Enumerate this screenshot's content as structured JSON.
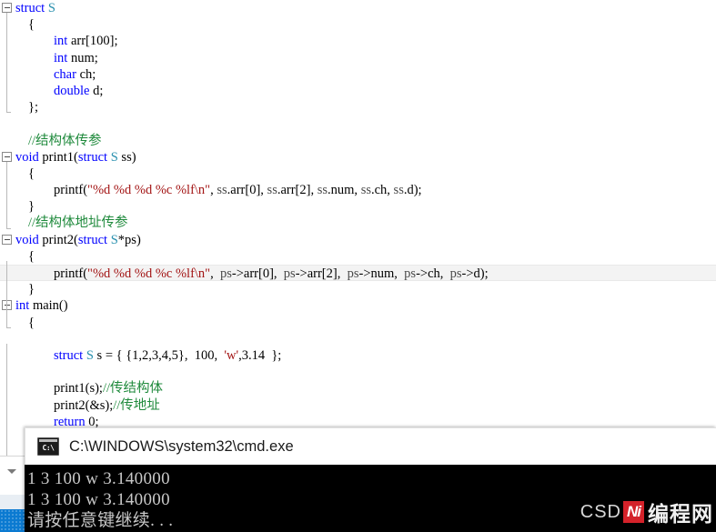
{
  "editor": {
    "lines": [
      {
        "indent": 0,
        "fold": true,
        "segments": [
          {
            "t": "struct ",
            "c": "kw"
          },
          {
            "t": "S",
            "c": "typ"
          }
        ]
      },
      {
        "indent": 14,
        "fold": false,
        "segments": [
          {
            "t": "{",
            "c": "plain"
          }
        ]
      },
      {
        "indent": 42,
        "fold": false,
        "segments": [
          {
            "t": "int",
            "c": "kw"
          },
          {
            "t": " arr[100];",
            "c": "plain"
          }
        ]
      },
      {
        "indent": 42,
        "fold": false,
        "segments": [
          {
            "t": "int",
            "c": "kw"
          },
          {
            "t": " num;",
            "c": "plain"
          }
        ]
      },
      {
        "indent": 42,
        "fold": false,
        "segments": [
          {
            "t": "char",
            "c": "kw"
          },
          {
            "t": " ch;",
            "c": "plain"
          }
        ]
      },
      {
        "indent": 42,
        "fold": false,
        "segments": [
          {
            "t": "double",
            "c": "kw"
          },
          {
            "t": " d;",
            "c": "plain"
          }
        ]
      },
      {
        "indent": 14,
        "fold": false,
        "segments": [
          {
            "t": "};",
            "c": "plain"
          }
        ]
      },
      {
        "indent": 0,
        "fold": false,
        "segments": []
      },
      {
        "indent": 14,
        "fold": false,
        "segments": [
          {
            "t": "//结构体传参",
            "c": "cmt"
          }
        ]
      },
      {
        "indent": 0,
        "fold": true,
        "segments": [
          {
            "t": "void",
            "c": "kw"
          },
          {
            "t": " print1(",
            "c": "plain"
          },
          {
            "t": "struct",
            "c": "kw"
          },
          {
            "t": " ",
            "c": "plain"
          },
          {
            "t": "S",
            "c": "typ"
          },
          {
            "t": " ss)",
            "c": "plain"
          }
        ]
      },
      {
        "indent": 14,
        "fold": false,
        "segments": [
          {
            "t": "{",
            "c": "plain"
          }
        ]
      },
      {
        "indent": 42,
        "fold": false,
        "segments": [
          {
            "t": "printf(",
            "c": "plain"
          },
          {
            "t": "\"%d %d %d %c %lf\\n\"",
            "c": "str"
          },
          {
            "t": ", ",
            "c": "plain"
          },
          {
            "t": "ss",
            "c": "var"
          },
          {
            "t": ".arr[0], ",
            "c": "plain"
          },
          {
            "t": "ss",
            "c": "var"
          },
          {
            "t": ".arr[2], ",
            "c": "plain"
          },
          {
            "t": "ss",
            "c": "var"
          },
          {
            "t": ".num, ",
            "c": "plain"
          },
          {
            "t": "ss",
            "c": "var"
          },
          {
            "t": ".ch, ",
            "c": "plain"
          },
          {
            "t": "ss",
            "c": "var"
          },
          {
            "t": ".d);",
            "c": "plain"
          }
        ]
      },
      {
        "indent": 14,
        "fold": false,
        "segments": [
          {
            "t": "}",
            "c": "plain"
          }
        ]
      },
      {
        "indent": 14,
        "fold": false,
        "segments": [
          {
            "t": "//结构体地址传参",
            "c": "cmt"
          }
        ]
      },
      {
        "indent": 0,
        "fold": true,
        "segments": [
          {
            "t": "void",
            "c": "kw"
          },
          {
            "t": " print2(",
            "c": "plain"
          },
          {
            "t": "struct",
            "c": "kw"
          },
          {
            "t": " ",
            "c": "plain"
          },
          {
            "t": "S",
            "c": "typ"
          },
          {
            "t": "*ps)",
            "c": "plain"
          }
        ]
      },
      {
        "indent": 14,
        "fold": false,
        "segments": [
          {
            "t": "{",
            "c": "plain"
          }
        ]
      },
      {
        "indent": 42,
        "fold": false,
        "highlight": true,
        "segments": [
          {
            "t": "printf(",
            "c": "plain"
          },
          {
            "t": "\"%d %d %d %c %lf\\n\"",
            "c": "str"
          },
          {
            "t": ",  ",
            "c": "plain"
          },
          {
            "t": "ps",
            "c": "var"
          },
          {
            "t": "->arr[0],  ",
            "c": "plain"
          },
          {
            "t": "ps",
            "c": "var"
          },
          {
            "t": "->arr[2],  ",
            "c": "plain"
          },
          {
            "t": "ps",
            "c": "var"
          },
          {
            "t": "->num,  ",
            "c": "plain"
          },
          {
            "t": "ps",
            "c": "var"
          },
          {
            "t": "->ch,  ",
            "c": "plain"
          },
          {
            "t": "ps",
            "c": "var"
          },
          {
            "t": "->d);",
            "c": "plain"
          }
        ]
      },
      {
        "indent": 14,
        "fold": false,
        "segments": [
          {
            "t": "}",
            "c": "plain"
          }
        ]
      },
      {
        "indent": 0,
        "fold": true,
        "segments": [
          {
            "t": "int",
            "c": "kw"
          },
          {
            "t": " main()",
            "c": "plain"
          }
        ]
      },
      {
        "indent": 14,
        "fold": false,
        "segments": [
          {
            "t": "{",
            "c": "plain"
          }
        ]
      },
      {
        "indent": 0,
        "fold": false,
        "segments": []
      },
      {
        "indent": 42,
        "fold": false,
        "segments": [
          {
            "t": "struct",
            "c": "kw"
          },
          {
            "t": " ",
            "c": "plain"
          },
          {
            "t": "S",
            "c": "typ"
          },
          {
            "t": " s = { {1,2,3,4,5},  100,  ",
            "c": "plain"
          },
          {
            "t": "'w'",
            "c": "str"
          },
          {
            "t": ",3.14  };",
            "c": "plain"
          }
        ]
      },
      {
        "indent": 0,
        "fold": false,
        "segments": []
      },
      {
        "indent": 42,
        "fold": false,
        "segments": [
          {
            "t": "print1(s);",
            "c": "plain"
          },
          {
            "t": "//传结构体",
            "c": "cmt"
          }
        ]
      },
      {
        "indent": 42,
        "fold": false,
        "segments": [
          {
            "t": "print2(&s);",
            "c": "plain"
          },
          {
            "t": "//传地址",
            "c": "cmt"
          }
        ]
      },
      {
        "indent": 42,
        "fold": false,
        "segments": [
          {
            "t": "return",
            "c": "kw"
          },
          {
            "t": " 0;",
            "c": "plain"
          }
        ]
      },
      {
        "indent": 14,
        "fold": false,
        "segments": [
          {
            "t": "}",
            "c": "plain"
          }
        ]
      }
    ]
  },
  "console": {
    "title": "C:\\WINDOWS\\system32\\cmd.exe",
    "icon_label": "C:\\",
    "output": [
      "1 3 100 w 3.140000",
      "1 3 100 w 3.140000",
      "请按任意键继续. . ."
    ]
  },
  "watermark": {
    "prefix": "CSD",
    "logo": "Ni",
    "suffix": "编程网"
  },
  "colors": {
    "keyword": "#0000ff",
    "type": "#2b91af",
    "comment": "#1f8a3c",
    "string": "#a31515",
    "console_bg": "#000000",
    "console_fg": "#c8c8c8",
    "taskbar": "#0b7ad1",
    "logo_red": "#d4222a"
  }
}
